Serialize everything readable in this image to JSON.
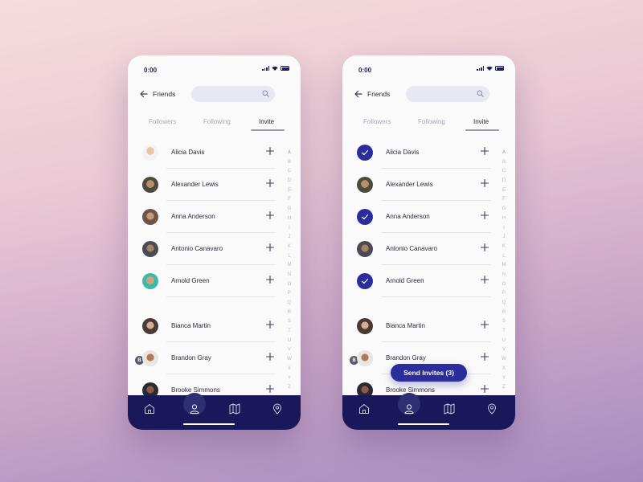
{
  "colors": {
    "accent": "#2b2d9a",
    "nav_bg": "#18185a",
    "search_bg": "#e8e8f5",
    "text_primary": "#2c2c3a",
    "text_muted": "#a9a9b8"
  },
  "left": {
    "status": {
      "time": "0:00"
    },
    "header": {
      "title": "Friends",
      "search_placeholder": ""
    },
    "tabs": [
      {
        "label": "Followers",
        "active": false
      },
      {
        "label": "Following",
        "active": false
      },
      {
        "label": "Invite",
        "active": true
      }
    ],
    "contacts": [
      {
        "name": "Alicia Davis",
        "checked": false
      },
      {
        "name": "Alexander Lewis",
        "checked": false
      },
      {
        "name": "Anna Anderson",
        "checked": false
      },
      {
        "name": "Antonio Canavaro",
        "checked": false
      },
      {
        "name": "Arnold Green",
        "checked": false
      },
      {
        "name": "Bianca Martin",
        "checked": false
      },
      {
        "name": "Brandon Gray",
        "checked": false
      },
      {
        "name": "Brooke Simmons",
        "checked": false
      }
    ],
    "section_letter": "B",
    "nav_items": [
      "home-icon",
      "profile-icon",
      "map-icon",
      "location-icon"
    ]
  },
  "right": {
    "status": {
      "time": "0:00"
    },
    "header": {
      "title": "Friends",
      "search_placeholder": ""
    },
    "tabs": [
      {
        "label": "Followers",
        "active": false
      },
      {
        "label": "Following",
        "active": false
      },
      {
        "label": "Invite",
        "active": true
      }
    ],
    "contacts": [
      {
        "name": "Alicia Davis",
        "checked": true
      },
      {
        "name": "Alexander Lewis",
        "checked": false
      },
      {
        "name": "Anna Anderson",
        "checked": true
      },
      {
        "name": "Antonio Canavaro",
        "checked": false
      },
      {
        "name": "Arnold Green",
        "checked": true
      },
      {
        "name": "Bianca Martin",
        "checked": false
      },
      {
        "name": "Brandon Gray",
        "checked": false
      },
      {
        "name": "Brooke Simmons",
        "checked": false
      }
    ],
    "section_letter": "B",
    "invite_button": "Send Invites (3)",
    "nav_items": [
      "home-icon",
      "profile-icon",
      "map-icon",
      "location-icon"
    ]
  },
  "alphabet": [
    "A",
    "B",
    "C",
    "D",
    "E",
    "F",
    "G",
    "H",
    "I",
    "J",
    "K",
    "L",
    "M",
    "N",
    "O",
    "P",
    "Q",
    "R",
    "S",
    "T",
    "U",
    "V",
    "W",
    "X",
    "Y",
    "Z"
  ]
}
